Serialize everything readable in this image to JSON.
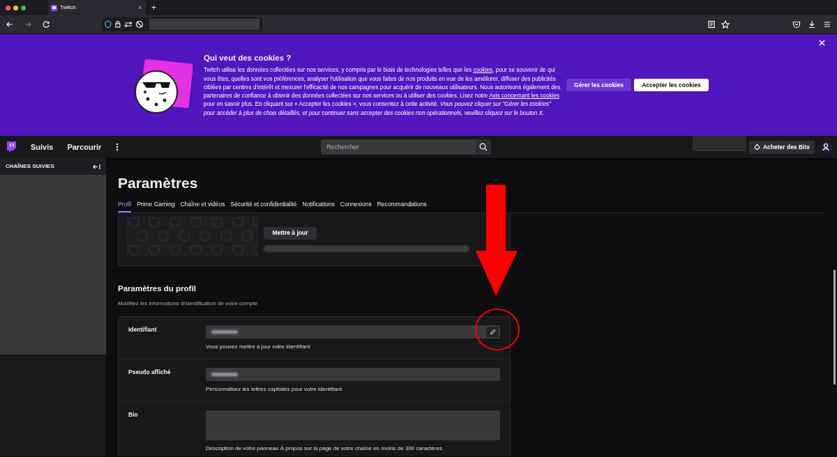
{
  "browser": {
    "tab_title": "Twitch",
    "new_tab": "+"
  },
  "cookie_banner": {
    "title": "Qui veut des cookies ?",
    "body_parts": [
      {
        "kind": "text",
        "text": "Twitch utilise les données collectées sur nos services, y compris par le biais de technologies telles que les "
      },
      {
        "kind": "link",
        "text": "cookies"
      },
      {
        "kind": "text",
        "text": ", pour se souvenir de qui vous êtes, quelles sont vos préférences, analyser l'utilisation que vous faites de nos produits en vue de les améliorer, diffuser des publicités ciblées par centres d'intérêt et mesurer l'efficacité de nos campagnes pour acquérir de nouveaux utilisateurs. Nous autorisons également des partenaires de confiance à obtenir des données collectées sur nos services ou à utiliser des cookies. Lisez notre "
      },
      {
        "kind": "link",
        "text": "Avis concernant les cookies"
      },
      {
        "kind": "text",
        "text": " pour en savoir plus. En cliquant sur « Accepter les cookies », vous consentez à cette activité. "
      },
      {
        "kind": "note",
        "text": "Vous pouvez cliquer sur \"Gérer les cookies\" pour accéder à plus de choix détaillés, et pour continuer sans accepter des cookies non opérationnels, veuillez cliquez sur le bouton X."
      }
    ],
    "buttons": [
      {
        "label": "Gérer les cookies",
        "kind": "secondary"
      },
      {
        "label": "Accepter les cookies",
        "kind": "primary"
      }
    ]
  },
  "topnav": {
    "links": [
      "Suivis",
      "Parcourir"
    ],
    "search": {
      "placeholder": "Rechercher"
    },
    "bits_button": "Acheter des Bits"
  },
  "sidebar": {
    "title": "CHAÎNES SUIVIES"
  },
  "page": {
    "title": "Paramètres",
    "tabs": [
      {
        "label": "Profil",
        "selected": true
      },
      {
        "label": "Prime Gaming",
        "selected": false
      },
      {
        "label": "Chaîne et vidéos",
        "selected": false
      },
      {
        "label": "Sécurité et confidentialité",
        "selected": false
      },
      {
        "label": "Notifications",
        "selected": false
      },
      {
        "label": "Connexions",
        "selected": false
      },
      {
        "label": "Recommandations",
        "selected": false
      }
    ],
    "update_button": "Mettre à jour",
    "section": {
      "title": "Paramètres du profil",
      "subtitle": "Modifiez les informations d'identification de votre compte",
      "fields": [
        {
          "label": "Identifiant",
          "kind": "input_edit",
          "help": "Vous pouvez mettre à jour votre identifiant"
        },
        {
          "label": "Pseudo affiché",
          "kind": "input",
          "help": "Personnalisez les lettres capitales pour votre identifiant"
        },
        {
          "label": "Bio",
          "kind": "textarea",
          "help": "Description de votre panneau À propos sur la page de votre chaîne en moins de 300 caractères"
        }
      ]
    }
  }
}
